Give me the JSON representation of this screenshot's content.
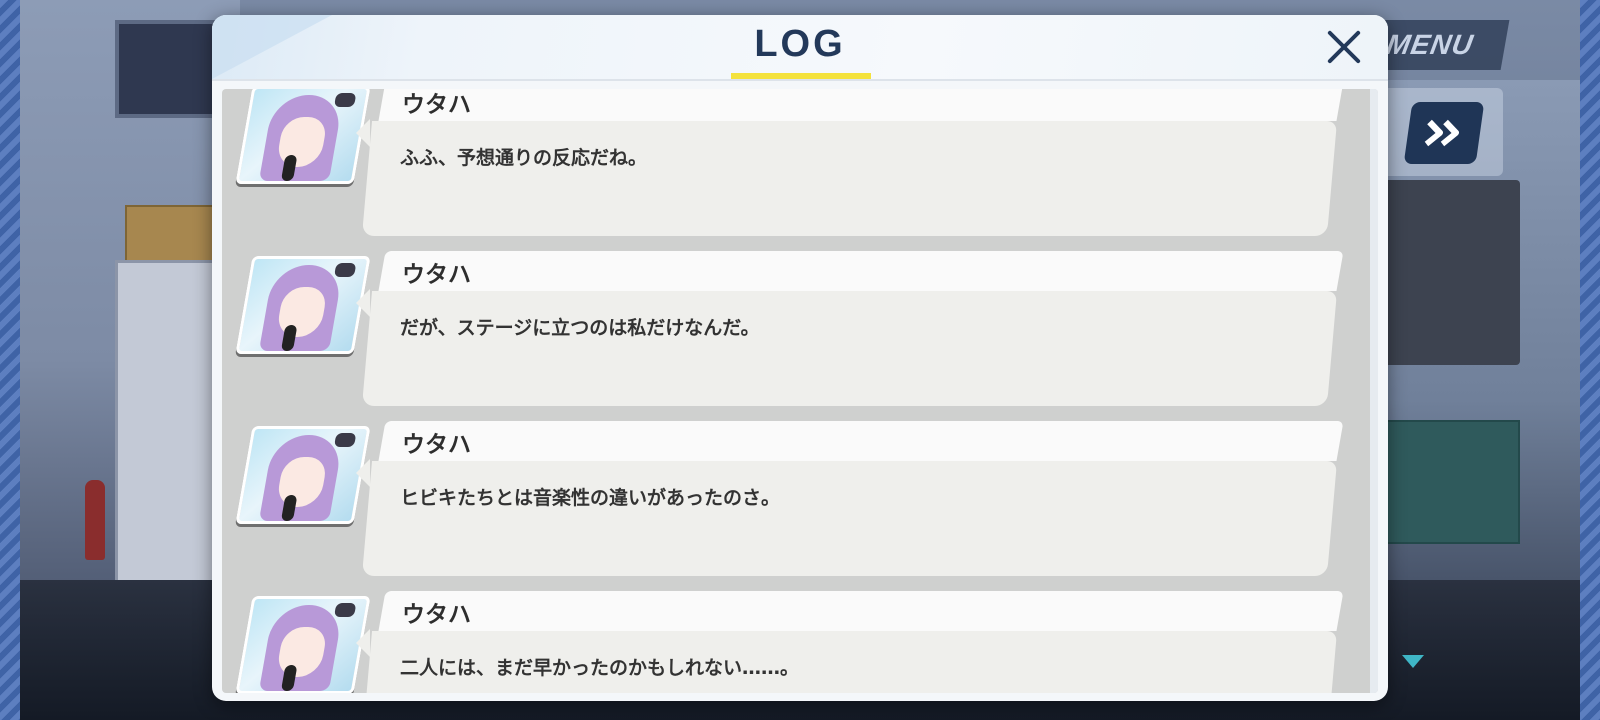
{
  "hud": {
    "menu_label": "MENU",
    "fast_forward_icon": "double-chevron-right-icon",
    "next_icon": "triangle-down-icon"
  },
  "log": {
    "title": "LOG",
    "close_icon": "close-x-icon",
    "entries": [
      {
        "speaker": "ウタハ",
        "text": "ふふ、予想通りの反応だね。"
      },
      {
        "speaker": "ウタハ",
        "text": "だが、ステージに立つのは私だけなんだ。"
      },
      {
        "speaker": "ウタハ",
        "text": "ヒビキたちとは音楽性の違いがあったのさ。"
      },
      {
        "speaker": "ウタハ",
        "text": "二人には、まだ早かったのかもしれない……。"
      }
    ]
  },
  "colors": {
    "title": "#23395a",
    "underline": "#f4e23c",
    "bubble": "#efefec",
    "name_tab": "#fafafa"
  }
}
